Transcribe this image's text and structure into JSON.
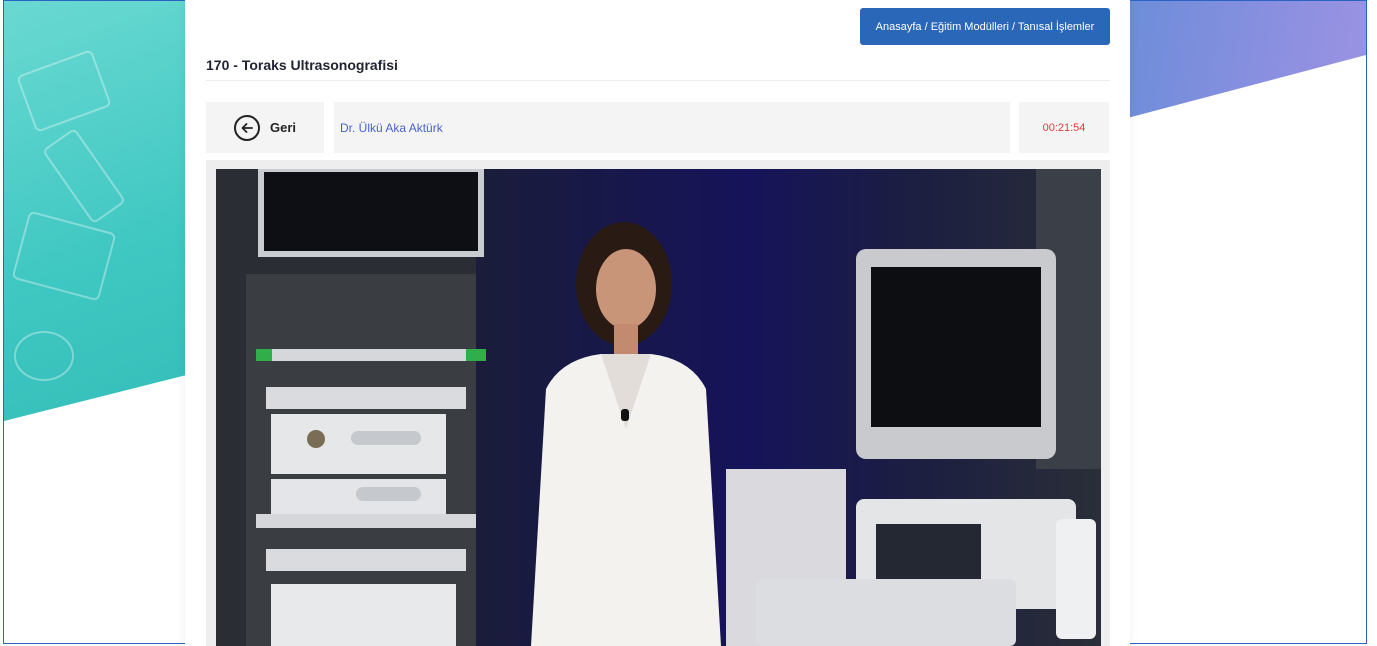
{
  "breadcrumb": {
    "label": "Anasayfa / Eğitim Modülleri / Tanısal İşlemler"
  },
  "page": {
    "title": "170 - Toraks Ultrasonografisi"
  },
  "player": {
    "back_label": "Geri",
    "instructor": "Dr. Ülkü Aka Aktürk",
    "timer": "00:21:54"
  },
  "colors": {
    "primary": "#2a67b8",
    "instructor_text": "#4a62c9",
    "timer_text": "#e23a3a",
    "teal_bg": "#3fc7c2",
    "purple_bg": "#8a8fe0"
  }
}
